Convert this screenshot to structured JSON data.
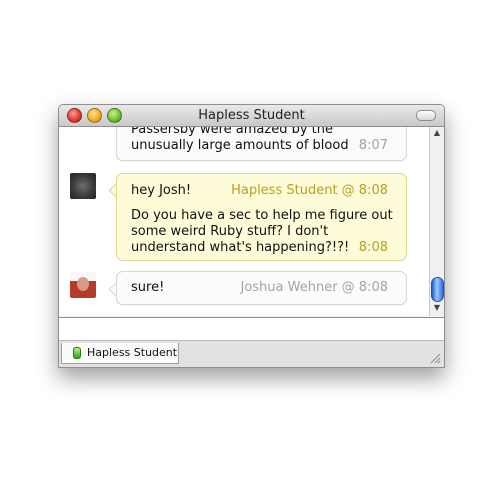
{
  "window": {
    "title": "Hapless Student",
    "buttons": {
      "close": "close",
      "minimize": "minimize",
      "zoom": "zoom"
    }
  },
  "messages": [
    {
      "lines": [
        "Passersby were amazed by the",
        "unusually large amounts of blood"
      ],
      "meta": "8:07"
    },
    {
      "header_text": "hey Josh!",
      "header_meta": "Hapless Student @ 8:08",
      "lines": [
        "Do you have a sec to help me figure out",
        "some weird Ruby stuff? I don't",
        "understand what's happening?!?!"
      ],
      "meta": "8:08"
    },
    {
      "text": "sure!",
      "meta": "Joshua Wehner @ 8:08"
    }
  ],
  "input": {
    "value": ""
  },
  "tabs": [
    {
      "label": "Hapless Student",
      "status_icon": "online-status-icon"
    }
  ],
  "colors": {
    "gold_timestamp": "#b5a222",
    "grey_timestamp": "#a3a3a3",
    "yellow_bubble": "#fdfbd8",
    "scroll_thumb": "#2b6fe0"
  }
}
